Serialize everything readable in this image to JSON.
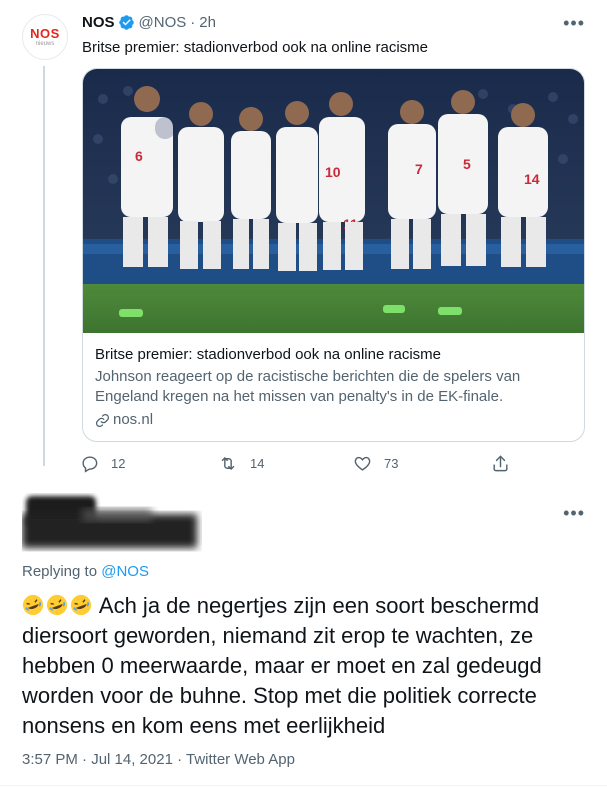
{
  "tweet": {
    "author_name": "NOS",
    "handle": "@NOS",
    "separator": "·",
    "time": "2h",
    "text": "Britse premier: stadionverbod ook na online racisme",
    "avatar": {
      "logo": "NOS",
      "sub": "nieuws"
    },
    "card": {
      "title": "Britse premier: stadionverbod ook na online racisme",
      "description": "Johnson reageert op de racistische berichten die de spelers van Engeland kregen na het missen van penalty's in de EK-finale.",
      "domain": "nos.nl"
    },
    "actions": {
      "replies": "12",
      "retweets": "14",
      "likes": "73"
    },
    "more_label": "•••"
  },
  "reply": {
    "replying_prefix": "Replying to",
    "replying_to": "@NOS",
    "text": "Ach ja de negertjes zijn een soort beschermd diersoort geworden, niemand zit erop te wachten, ze hebben 0 meerwaarde, maar er moet en zal gedeugd worden voor de buhne. Stop met die politiek correcte nonsens en kom eens met eerlijkheid",
    "emoji": [
      "rofl-emoji",
      "rofl-emoji",
      "rofl-emoji"
    ],
    "timestamp": "3:57 PM · Jul 14, 2021 · Twitter Web App",
    "more_label": "•••"
  },
  "icons": [
    "verified-icon",
    "reply-icon",
    "retweet-icon",
    "like-icon",
    "share-icon",
    "link-icon",
    "more-icon"
  ],
  "colors": {
    "accent": "#1d9bf0",
    "secondary_text": "#536471",
    "nos_red": "#e4261c"
  }
}
